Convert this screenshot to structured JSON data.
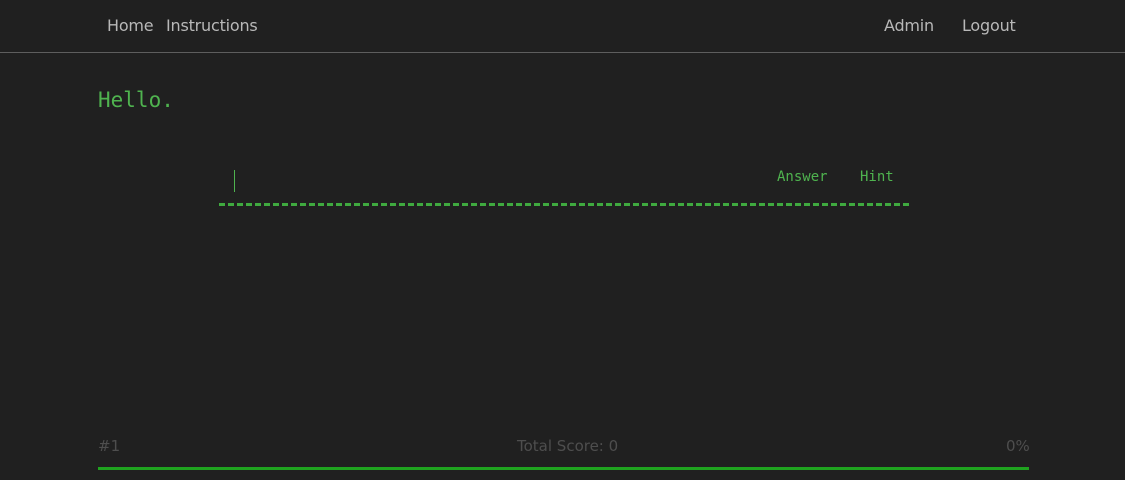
{
  "nav": {
    "home": "Home",
    "instructions": "Instructions",
    "admin": "Admin",
    "logout": "Logout"
  },
  "main": {
    "greeting": "Hello.",
    "answer_value": "",
    "answer_label": "Answer",
    "hint_label": "Hint"
  },
  "footer": {
    "level": "#1",
    "total_score": "Total Score: 0",
    "progress_text": "0%",
    "progress_fraction": 0
  },
  "colors": {
    "background": "#202020",
    "accent_green": "#4fb34f",
    "nav_text": "#b8b8b8",
    "muted_text": "#4e4e4e"
  }
}
